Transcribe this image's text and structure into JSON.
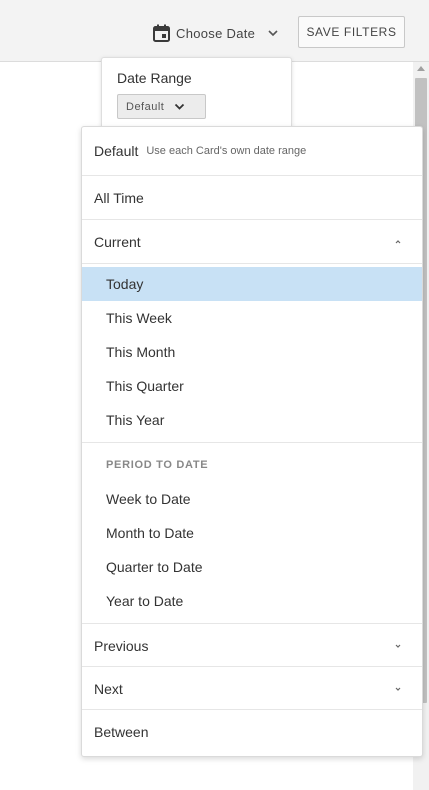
{
  "toolbar": {
    "choose_date_label": "Choose Date",
    "save_filters_label": "SAVE FILTERS"
  },
  "date_range": {
    "title": "Date Range",
    "selected": "Default"
  },
  "menu": {
    "default": {
      "label": "Default",
      "hint": "Use each Card's own date range"
    },
    "all_time": "All Time",
    "current": {
      "label": "Current",
      "items": [
        "Today",
        "This Week",
        "This Month",
        "This Quarter",
        "This Year"
      ],
      "selected_index": 0
    },
    "period_to_date": {
      "heading": "PERIOD TO DATE",
      "items": [
        "Week to Date",
        "Month to Date",
        "Quarter to Date",
        "Year to Date"
      ]
    },
    "previous": "Previous",
    "next": "Next",
    "between": "Between"
  },
  "colors": {
    "selected_bg": "#c8e1f5",
    "topbar_bg": "#f3f3f3"
  },
  "icons": [
    "calendar-icon",
    "chevron-down-icon",
    "chevron-up-icon"
  ]
}
